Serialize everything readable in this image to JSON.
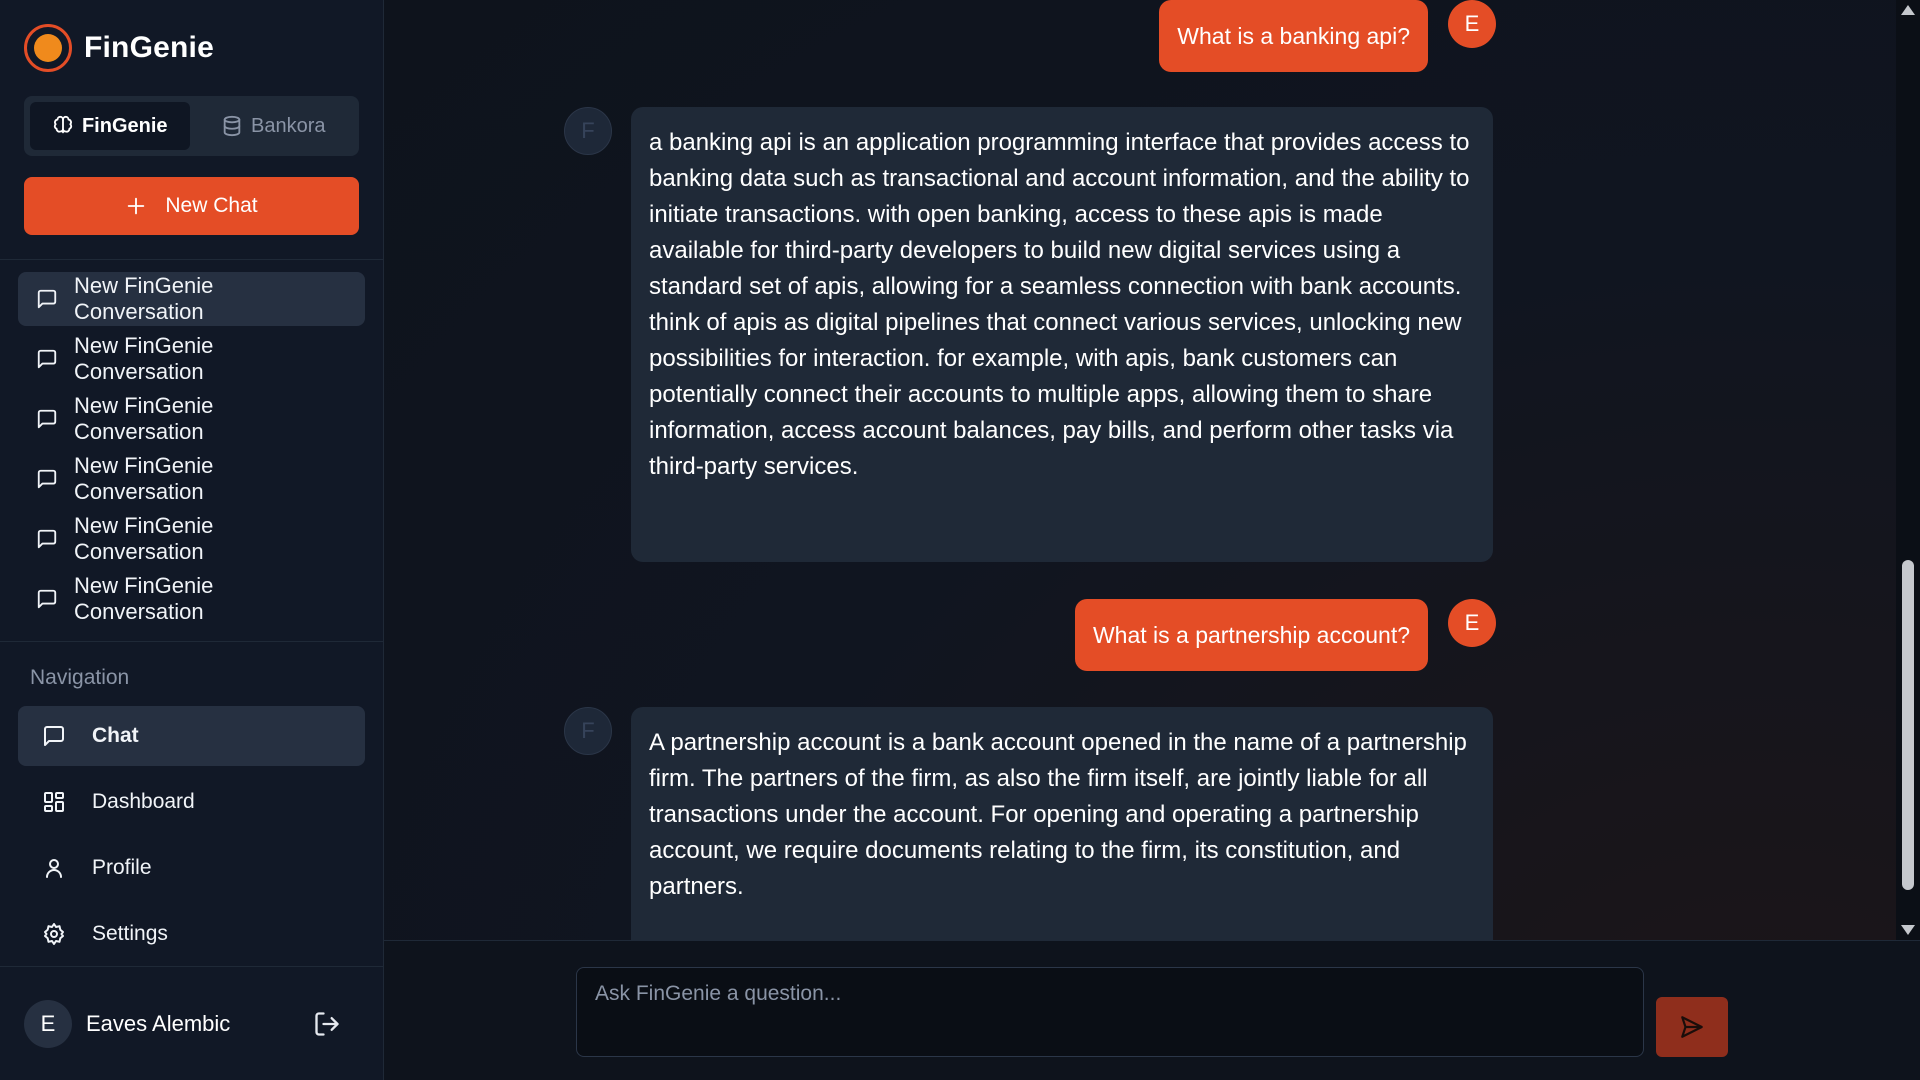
{
  "brand": {
    "name": "FinGenie"
  },
  "switcher": {
    "tabs": [
      {
        "label": "FinGenie",
        "icon": "brain-icon",
        "active": true
      },
      {
        "label": "Bankora",
        "icon": "database-icon",
        "active": false
      }
    ]
  },
  "new_chat": {
    "label": "New Chat"
  },
  "conversations": [
    {
      "label": "New FinGenie Conversation",
      "active": true
    },
    {
      "label": "New FinGenie Conversation",
      "active": false
    },
    {
      "label": "New FinGenie Conversation",
      "active": false
    },
    {
      "label": "New FinGenie Conversation",
      "active": false
    },
    {
      "label": "New FinGenie Conversation",
      "active": false
    },
    {
      "label": "New FinGenie Conversation",
      "active": false
    }
  ],
  "navigation": {
    "title": "Navigation",
    "items": [
      {
        "label": "Chat",
        "icon": "chat-icon",
        "active": true
      },
      {
        "label": "Dashboard",
        "icon": "dashboard-icon",
        "active": false
      },
      {
        "label": "Profile",
        "icon": "user-icon",
        "active": false
      },
      {
        "label": "Settings",
        "icon": "gear-icon",
        "active": false
      }
    ]
  },
  "user": {
    "initial": "E",
    "name": "Eaves Alembic"
  },
  "messages": [
    {
      "role": "user",
      "avatar": "E",
      "text": "What is a banking api?"
    },
    {
      "role": "assistant",
      "avatar": "F",
      "text": "a banking api is an application programming interface that provides access to banking data such as transactional and account information, and the ability to initiate transactions. with open banking, access to these apis is made available for third-party developers to build new digital services using a standard set of apis, allowing for a seamless connection with bank accounts. think of apis as digital pipelines that connect various services, unlocking new possibilities for interaction. for example, with apis, bank customers can potentially connect their accounts to multiple apps, allowing them to share information, access account balances, pay bills, and perform other tasks via third-party services."
    },
    {
      "role": "user",
      "avatar": "E",
      "text": "What is a partnership account?"
    },
    {
      "role": "assistant",
      "avatar": "F",
      "text": "A partnership account is a bank account opened in the name of a partnership firm. The partners of the firm, as also the firm itself, are jointly liable for all transactions under the account. For opening and operating a partnership account, we require documents relating to the firm, its constitution, and partners."
    }
  ],
  "composer": {
    "placeholder": "Ask FinGenie a question...",
    "value": ""
  },
  "colors": {
    "accent": "#e44d26",
    "sidebar_bg": "#111826",
    "bubble_bot": "#1f2937",
    "send_disabled": "#8f2e1c"
  }
}
